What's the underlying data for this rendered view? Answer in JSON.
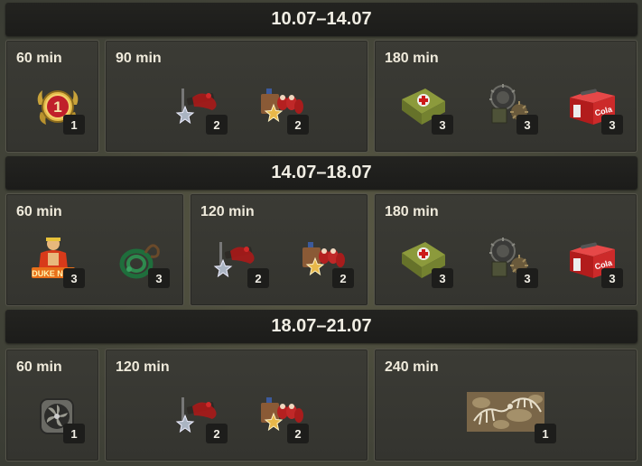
{
  "periods": [
    {
      "dates": "10.07–14.07",
      "groups": [
        {
          "duration": "60 min",
          "items": [
            {
              "icon": "level-1-medal-icon",
              "count": "1"
            }
          ]
        },
        {
          "duration": "90 min",
          "items": [
            {
              "icon": "silver-star-weapons-icon",
              "count": "2"
            },
            {
              "icon": "gold-star-squad-icon",
              "count": "2"
            }
          ]
        },
        {
          "duration": "180 min",
          "items": [
            {
              "icon": "medkit-icon",
              "count": "3"
            },
            {
              "icon": "spiked-mine-icon",
              "count": "3"
            },
            {
              "icon": "cola-box-icon",
              "count": "3"
            }
          ]
        }
      ]
    },
    {
      "dates": "14.07–18.07",
      "groups": [
        {
          "duration": "60 min",
          "items": [
            {
              "icon": "duke-nukem-icon",
              "count": "3"
            },
            {
              "icon": "green-rope-icon",
              "count": "3"
            }
          ]
        },
        {
          "duration": "120 min",
          "items": [
            {
              "icon": "silver-star-weapons-icon",
              "count": "2"
            },
            {
              "icon": "gold-star-squad-icon",
              "count": "2"
            }
          ]
        },
        {
          "duration": "180 min",
          "items": [
            {
              "icon": "medkit-icon",
              "count": "3"
            },
            {
              "icon": "spiked-mine-icon",
              "count": "3"
            },
            {
              "icon": "cola-box-icon",
              "count": "3"
            }
          ]
        }
      ]
    },
    {
      "dates": "18.07–21.07",
      "groups": [
        {
          "duration": "60 min",
          "items": [
            {
              "icon": "engine-fan-icon",
              "count": "1"
            }
          ]
        },
        {
          "duration": "120 min",
          "items": [
            {
              "icon": "silver-star-weapons-icon",
              "count": "2"
            },
            {
              "icon": "gold-star-squad-icon",
              "count": "2"
            }
          ]
        },
        {
          "duration": "240 min",
          "items": [
            {
              "icon": "dinosaur-fossil-camo-icon",
              "count": "1"
            }
          ]
        }
      ]
    }
  ]
}
